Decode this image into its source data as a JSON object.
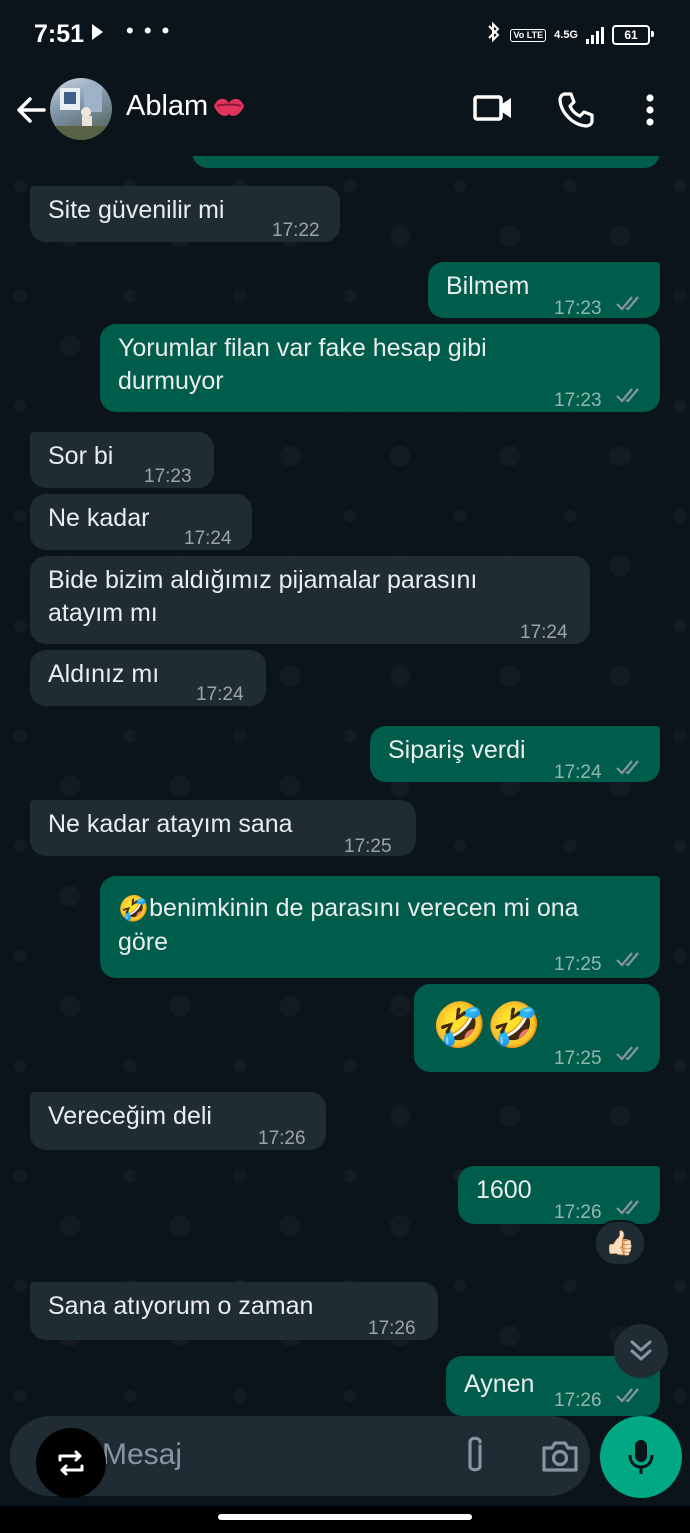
{
  "status": {
    "time": "7:51",
    "dots": "• • •",
    "volte": "Vo LTE",
    "network": "4.5G",
    "battery": "61"
  },
  "header": {
    "contact_name": "Ablam"
  },
  "messages": [
    {
      "dir": "out",
      "text": "",
      "time": ""
    },
    {
      "dir": "in",
      "text": "Site güvenilir mi",
      "time": "17:22"
    },
    {
      "dir": "out",
      "text": "Bilmem",
      "time": "17:23"
    },
    {
      "dir": "out",
      "text": "Yorumlar filan var fake hesap gibi\ndurmuyor",
      "time": "17:23"
    },
    {
      "dir": "in",
      "text": "Sor bi",
      "time": "17:23"
    },
    {
      "dir": "in",
      "text": "Ne kadar",
      "time": "17:24"
    },
    {
      "dir": "in",
      "text": "Bide bizim aldığımız pijamalar parasını\natayım mı",
      "time": "17:24"
    },
    {
      "dir": "in",
      "text": "Aldınız mı",
      "time": "17:24"
    },
    {
      "dir": "out",
      "text": "Sipariş verdi",
      "time": "17:24"
    },
    {
      "dir": "in",
      "text": "Ne kadar atayım sana",
      "time": "17:25"
    },
    {
      "dir": "out",
      "emoji": "🤣",
      "text": "benimkinin de parasını verecen mi ona\ngöre",
      "time": "17:25"
    },
    {
      "dir": "out",
      "emoji": "🤣🤣",
      "text": "",
      "time": "17:25"
    },
    {
      "dir": "in",
      "text": "Vereceğim deli",
      "time": "17:26"
    },
    {
      "dir": "out",
      "text": "1600",
      "time": "17:26",
      "reaction": "👍🏻"
    },
    {
      "dir": "in",
      "text": "Sana atıyorum o zaman",
      "time": "17:26"
    },
    {
      "dir": "out",
      "text": "Aynen",
      "time": "17:26"
    }
  ],
  "input": {
    "placeholder": "Mesaj"
  },
  "colors": {
    "background": "#0b141a",
    "incoming": "#202c33",
    "outgoing": "#005c4b",
    "accent": "#00a884",
    "read_ticks": "#8696a0"
  }
}
